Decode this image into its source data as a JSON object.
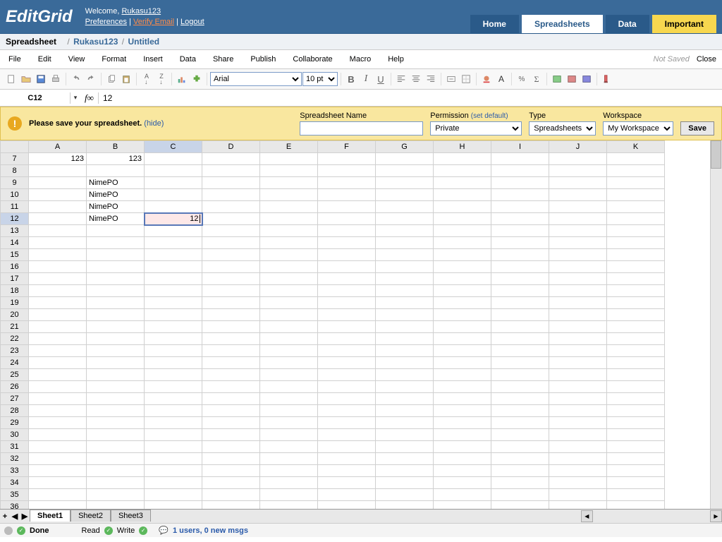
{
  "header": {
    "logo": "EditGrid",
    "welcome": "Welcome, ",
    "username": "Rukasu123",
    "preferences": "Preferences",
    "verify": "Verify Email",
    "logout": "Logout",
    "tabs": {
      "home": "Home",
      "spreadsheets": "Spreadsheets",
      "data": "Data",
      "important": "Important"
    }
  },
  "breadcrumb": {
    "label": "Spreadsheet",
    "user": "Rukasu123",
    "doc": "Untitled"
  },
  "menus": {
    "file": "File",
    "edit": "Edit",
    "view": "View",
    "format": "Format",
    "insert": "Insert",
    "data": "Data",
    "share": "Share",
    "publish": "Publish",
    "collaborate": "Collaborate",
    "macro": "Macro",
    "help": "Help",
    "notsaved": "Not Saved",
    "close": "Close"
  },
  "toolbar": {
    "font": "Arial",
    "size": "10 pt"
  },
  "fx": {
    "ref": "C12",
    "label": "f∞",
    "value": "12"
  },
  "savebar": {
    "icon": "!",
    "msg": "Please save your spreadsheet.",
    "hide": "(hide)",
    "name_label": "Spreadsheet Name",
    "perm_label": "Permission",
    "setdefault": "(set default)",
    "perm_value": "Private",
    "type_label": "Type",
    "type_value": "Spreadsheets",
    "ws_label": "Workspace",
    "ws_value": "My Workspace",
    "save": "Save"
  },
  "columns": [
    "A",
    "B",
    "C",
    "D",
    "E",
    "F",
    "G",
    "H",
    "I",
    "J",
    "K"
  ],
  "rows_start": 7,
  "rows_end": 36,
  "cells": {
    "A7": "123",
    "B7": "123",
    "B9": "NimePO",
    "B10": "NimePO",
    "B11": "NimePO",
    "B12": "NimePO",
    "C12": "12"
  },
  "active_cell": "C12",
  "sheets": {
    "s1": "Sheet1",
    "s2": "Sheet2",
    "s3": "Sheet3"
  },
  "status": {
    "done": "Done",
    "read": "Read",
    "write": "Write",
    "users": "1 users, 0 new msgs"
  }
}
